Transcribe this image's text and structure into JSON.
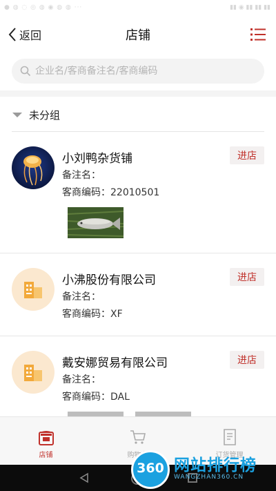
{
  "nav": {
    "back_label": "返回",
    "title": "店铺"
  },
  "search": {
    "placeholder": "企业名/客商备注名/客商编码"
  },
  "group": {
    "label": "未分组"
  },
  "stores": [
    {
      "name": "小刘鸭杂货铺",
      "remark": "备注名：",
      "code": "客商编码：22010501",
      "enter_label": "进店"
    },
    {
      "name": "小沸股份有限公司",
      "remark": "备注名：",
      "code": "客商编码：XF",
      "enter_label": "进店"
    },
    {
      "name": "戴安娜贸易有限公司",
      "remark": "备注名：",
      "code": "客商编码：DAL",
      "enter_label": "进店"
    }
  ],
  "tabs": [
    {
      "label": "店铺",
      "icon": "store-icon",
      "active": true
    },
    {
      "label": "购物车",
      "icon": "cart-icon",
      "active": false
    },
    {
      "label": "订货管理",
      "icon": "document-icon",
      "active": false
    }
  ],
  "watermark": {
    "number": "360",
    "cn": "网站排行榜",
    "en": "WANGZHAN360.CN"
  },
  "colors": {
    "accent": "#c0302a",
    "enter_bg": "#f3f0f0",
    "avatar_orange": "#fbe8cf",
    "building": "#f2a93b"
  }
}
